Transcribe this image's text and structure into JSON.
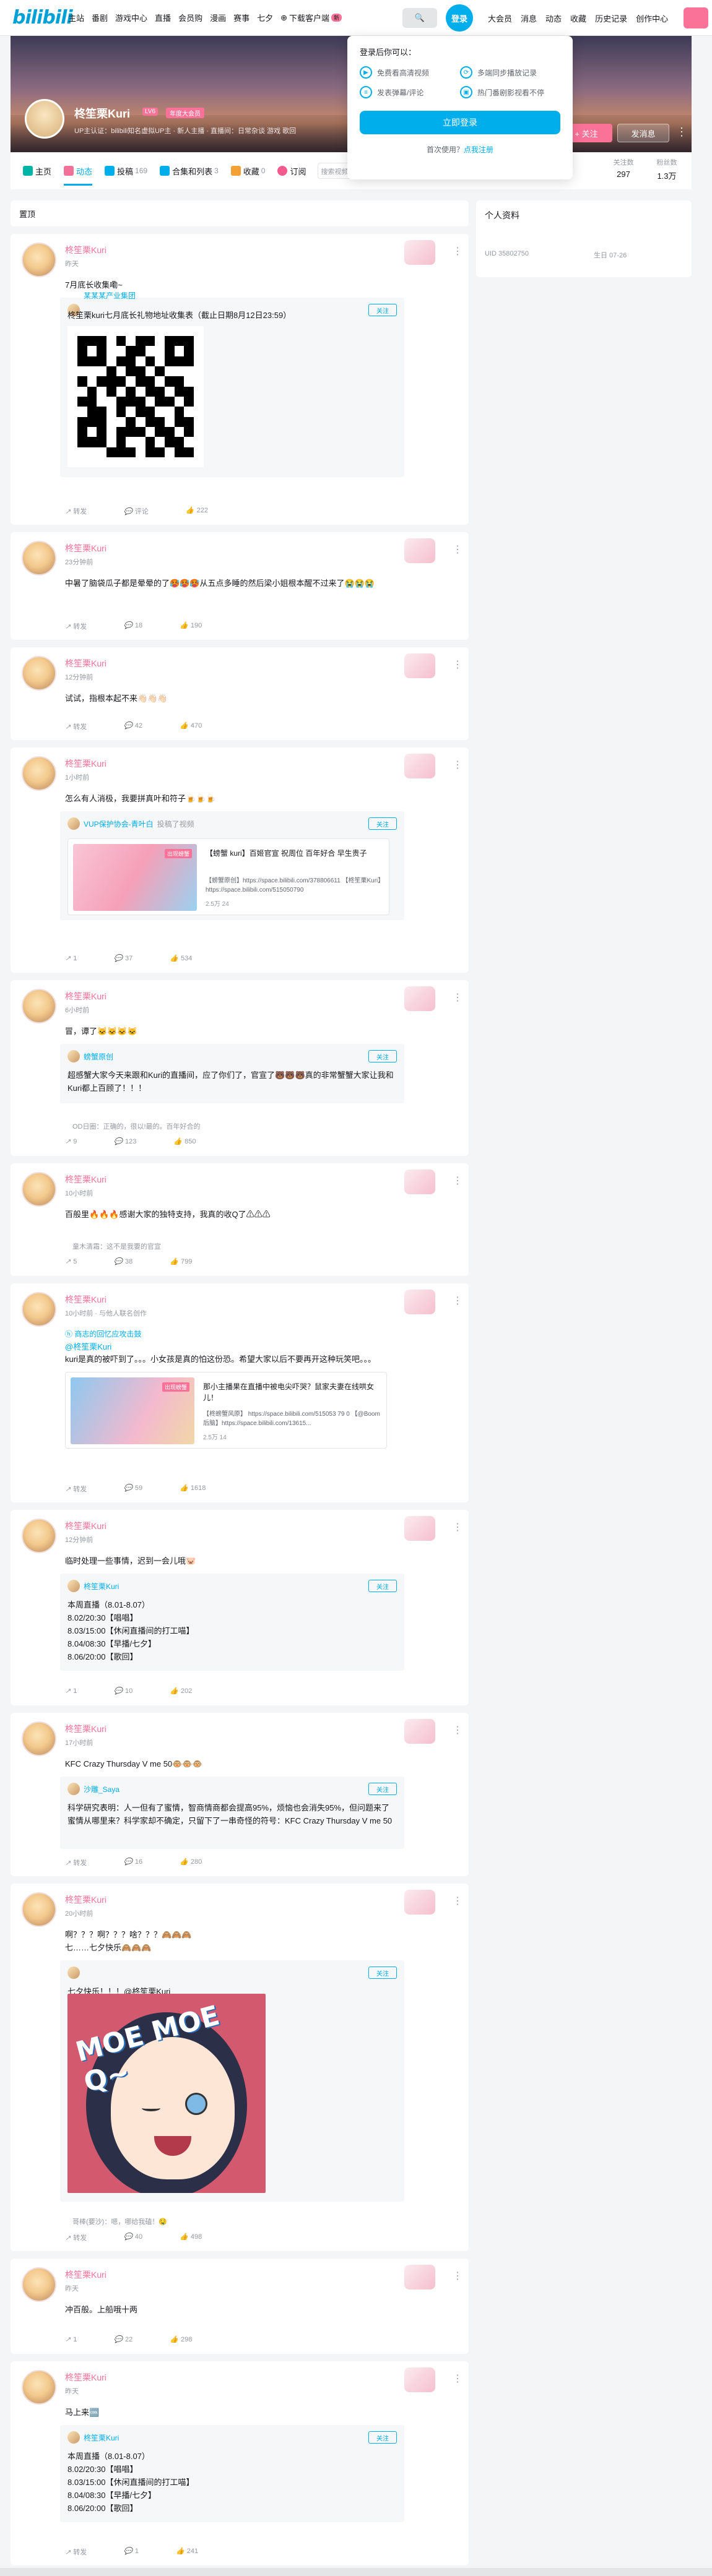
{
  "topbar": {
    "logo": "bilibili",
    "nav": [
      "主站",
      "番剧",
      "游戏中心",
      "直播",
      "会员购",
      "漫画",
      "赛事",
      "七夕"
    ],
    "download": "下载客户端",
    "download_badge": "新",
    "login": "登录",
    "right": [
      "大会员",
      "消息",
      "动态",
      "收藏",
      "历史记录",
      "创作中心"
    ]
  },
  "login_popup": {
    "title": "登录后你可以：",
    "benefits": [
      "免费看高清视频",
      "多端同步播放记录",
      "发表弹幕/评论",
      "热门番剧影视看不停"
    ],
    "button": "立即登录",
    "register_prefix": "首次使用？",
    "register_link": "点我注册"
  },
  "profile": {
    "name": "柊笙栗Kuri",
    "level": "LV6",
    "fan_badge": "年度大会员",
    "signature": "UP主认证：bilibili知名虚拟UP主 · 新人主播 · 直播间：日常杂谈 游戏 歌回",
    "follow": "+ 关注",
    "message": "发消息",
    "stats": [
      {
        "label": "关注数",
        "value": "297"
      },
      {
        "label": "粉丝数",
        "value": "1.3万"
      }
    ]
  },
  "tabs": [
    {
      "label": "主页",
      "count": ""
    },
    {
      "label": "动态",
      "count": ""
    },
    {
      "label": "投稿",
      "count": "169"
    },
    {
      "label": "合集和列表",
      "count": "3"
    },
    {
      "label": "收藏",
      "count": "0"
    },
    {
      "label": "订阅",
      "count": ""
    }
  ],
  "tab_search_placeholder": "搜索视频",
  "feed_header": "置顶",
  "sidebar": {
    "title": "个人资料",
    "uid": "UID 35802750",
    "birthday": "生日 07-26"
  },
  "posts": [
    {
      "name": "柊笙栗Kuri",
      "time": "昨天",
      "text": "7月底长收集嘞~",
      "repost": {
        "name": "某某某产业集团",
        "follow": "关注",
        "text": "柊笙栗kuri七月底长礼物地址收集表（截止日期8月12日23:59）"
      },
      "actions": {
        "share": "转发",
        "comment": "评论",
        "like": "222"
      }
    },
    {
      "name": "柊笙栗Kuri",
      "time": "23分钟前",
      "text": "中暑了脑袋瓜子都是晕晕的了🥵🥵🥵从五点多睡的然后梁小姐根本醒不过来了😭😭😭",
      "actions": {
        "share": "转发",
        "comment": "18",
        "like": "190"
      }
    },
    {
      "name": "柊笙栗Kuri",
      "time": "12分钟前",
      "text": "试试，指根本起不来👋🏻👋🏻👋🏻",
      "actions": {
        "share": "转发",
        "comment": "42",
        "like": "470"
      }
    },
    {
      "name": "柊笙栗Kuri",
      "time": "1小时前",
      "text": "怎么有人消极，我要拼真叶和符子🍺🍺🍺",
      "repost": {
        "name": "VUP保护协会-青叶白",
        "follow": "关注",
        "sub": "投稿了视频",
        "video": {
          "title": "【螃蟹 kuri】百姬官宣 祝周位 百年好合 早生贵子",
          "desc": "【螃蟹原创】https://space.bilibili.com/378806611 【柊笙栗Kuri】https://space.bilibili.com/515050790",
          "stats": "2.5万   24",
          "tag": "出现螃蟹"
        }
      },
      "actions": {
        "share": "1",
        "comment": "37",
        "like": "534"
      }
    },
    {
      "name": "柊笙栗Kuri",
      "time": "6小时前",
      "text": "冒，谭了🐱🐱🐱🐱",
      "repost": {
        "name": "螃蟹原创",
        "follow": "关注",
        "text": "超感蟹大家今天来跟和Kuri的直播间，应了你们了，官宣了🐻🐻🐻真的非常蟹蟹大家让我和Kuri都上百顾了！！！"
      },
      "comment": "OD日圈：正确的，很以!最的。百年好合的",
      "actions": {
        "share": "9",
        "comment": "123",
        "like": "850"
      }
    },
    {
      "name": "柊笙栗Kuri",
      "time": "10小时前",
      "text": "百般里🔥🔥🔥感谢大家的独特支持，我真的收Q了⚠⚠⚠",
      "comment": "童木清霜：这不是我要的官宣",
      "actions": {
        "share": "5",
        "comment": "38",
        "like": "799"
      }
    },
    {
      "name": "柊笙栗Kuri",
      "time": "10小时前 · 与他人联名创作",
      "pre": "ⓗ 商志的回忆应攻击鼓",
      "mention": "@柊笙栗Kuri",
      "text": "kuri是真的被吓到了。。。小女孩是真的怕这份恐。希望大家以后不要再开这种玩笑吧。。。",
      "video": {
        "title": "那小主播果在直播中被电尖吓哭？鼠家夫妻在线哄女儿！",
        "desc": "【柊螃蟹风原】 https://space.bilibili.com/515053 79 0 【@Boom后脑】https://space.bilibili.com/13615...",
        "stats": "2.5万   14",
        "tag": "出现螃蟹"
      },
      "actions": {
        "share": "转发",
        "comment": "59",
        "like": "1618"
      }
    },
    {
      "name": "柊笙栗Kuri",
      "time": "12分钟前",
      "text": "临时处理一些事情，迟到一会儿哦🐷",
      "repost": {
        "name": "柊笙栗Kuri",
        "follow": "关注",
        "lines": [
          "本周直播（8.01-8.07）",
          "8.02/20:30【唱唱】",
          "8.03/15:00【休闲直播间的打工喵】",
          "8.04/08:30【早播/七夕】",
          "8.06/20:00【歌回】"
        ]
      },
      "actions": {
        "share": "1",
        "comment": "10",
        "like": "202"
      }
    },
    {
      "name": "柊笙栗Kuri",
      "time": "17小时前",
      "text": "KFC Crazy Thursday V me 50🐵🐵🐵",
      "repost": {
        "name": "沙雕_Saya",
        "follow": "关注",
        "text": "科学研究表明：人一但有了蜜情，智商情商都会提高95%，烦恼也会消失95%，但问题来了 蜜情从哪里来？科学家却不确定，只留下了一串奇怪的符号：KFC Crazy Thursday V me 50"
      },
      "actions": {
        "share": "转发",
        "comment": "16",
        "like": "280"
      }
    },
    {
      "name": "柊笙栗Kuri",
      "time": "20小时前",
      "text": "啊？？？啊？？？啥？？？🙈🙈🙈\n七……七夕快乐🙈🙈🙈",
      "repost": {
        "name": "",
        "follow": "关注",
        "text": "七夕快乐！！！@柊笙栗Kuri",
        "moe": "MOE MOE Q~"
      },
      "comment": "哥棒(要沙)：嗯，哪给我磕！🤤",
      "actions": {
        "share": "转发",
        "comment": "40",
        "like": "498"
      }
    },
    {
      "name": "柊笙栗Kuri",
      "time": "昨天",
      "text": "冲百般。上船哦十两",
      "actions": {
        "share": "1",
        "comment": "22",
        "like": "298"
      }
    },
    {
      "name": "柊笙栗Kuri",
      "time": "昨天",
      "text": "马上来🆒",
      "repost": {
        "name": "柊笙栗Kuri",
        "follow": "关注",
        "lines": [
          "本周直播（8.01-8.07）",
          "8.02/20:30【唱唱】",
          "8.03/15:00【休闲直播间的打工喵】",
          "8.04/08:30【早播/七夕】",
          "8.06/20:00【歌回】"
        ]
      },
      "actions": {
        "share": "转发",
        "comment": "1",
        "like": "241"
      }
    }
  ]
}
